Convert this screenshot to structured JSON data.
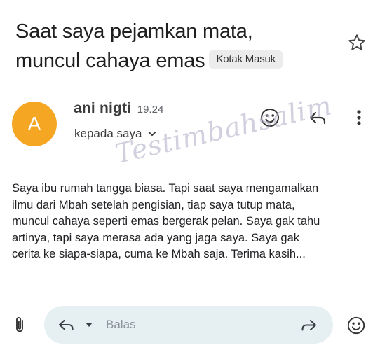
{
  "header": {
    "subject_lines": [
      "Saat saya pejamkan mata,",
      "muncul cahaya emas"
    ],
    "label_chip": "Kotak Masuk",
    "star_icon": "star-outline-icon"
  },
  "sender": {
    "avatar_letter": "A",
    "avatar_color": "#f5a623",
    "name": "ani nigti",
    "time": "19.24",
    "recipient": "kepada saya",
    "icons": [
      "emoji-icon",
      "reply-icon",
      "more-vert-icon"
    ]
  },
  "watermark": "Testimbahsalim",
  "message": {
    "lines": [
      "Saya ibu rumah tangga biasa. Tapi saat saya mengamalkan",
      "ilmu dari Mbah setelah pengisian, tiap saya tutup mata,",
      "muncul cahaya seperti emas bergerak pelan. Saya gak tahu",
      "artinya, tapi saya merasa ada yang jaga saya. Saya gak",
      "cerita ke siapa-siapa, cuma ke Mbah saja. Terima kasih..."
    ]
  },
  "reply_bar": {
    "placeholder": "Balas",
    "value": "",
    "pill_color": "#e6f0f3",
    "icons": [
      "attachment-icon",
      "reply-icon",
      "dropdown-arrow-icon",
      "forward-icon",
      "emoji-icon"
    ]
  }
}
